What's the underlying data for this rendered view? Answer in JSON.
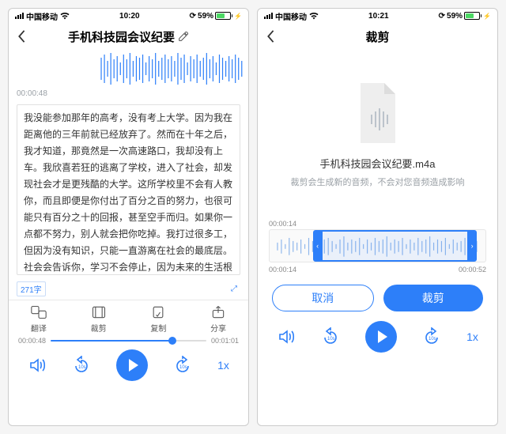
{
  "status": {
    "carrier": "中国移动",
    "battery_pct": "59%"
  },
  "left": {
    "status_time": "10:20",
    "title": "手机科技园会议纪要",
    "wave_time": "00:00:48",
    "transcript": "我没能参加那年的高考，没有考上大学。因为我在距离他的三年前就已经放弃了。然而在十年之后，我才知道，那竟然是一次高速路口，我却没有上车。我欣喜若狂的逃离了学校，进入了社会，却发现社会才是更残酷的大学。这所学校里不会有人教你，而且即便是你付出了百分之百的努力，也很可能只有百分之十的回报，甚至空手而归。如果你一点都不努力，别人就会把你吃掉。我打过很多工，但因为没有知识，只能一直游离在社会的最底层。社会会告诉你，学习不会停止，因为未来的生活根本不允许你停止，所以不到最后一刻永远不要放弃。因为这很可能是你人生性价比最高的一次努力了。加油抖音。",
    "word_count": "271字",
    "actions": {
      "translate": "翻译",
      "trim": "裁剪",
      "copy": "复制",
      "share": "分享"
    },
    "timeline_start": "00:00:48",
    "timeline_end": "00:01:01",
    "speed": "1x"
  },
  "right": {
    "status_time": "10:21",
    "title": "裁剪",
    "filename": "手机科技园会议纪要.m4a",
    "hint": "裁剪会生成新的音频，不会对您音频造成影响",
    "sel_time": "00:00:14",
    "trim_start": "00:00:14",
    "trim_end": "00:00:52",
    "cancel": "取消",
    "confirm": "裁剪",
    "speed": "1x"
  }
}
